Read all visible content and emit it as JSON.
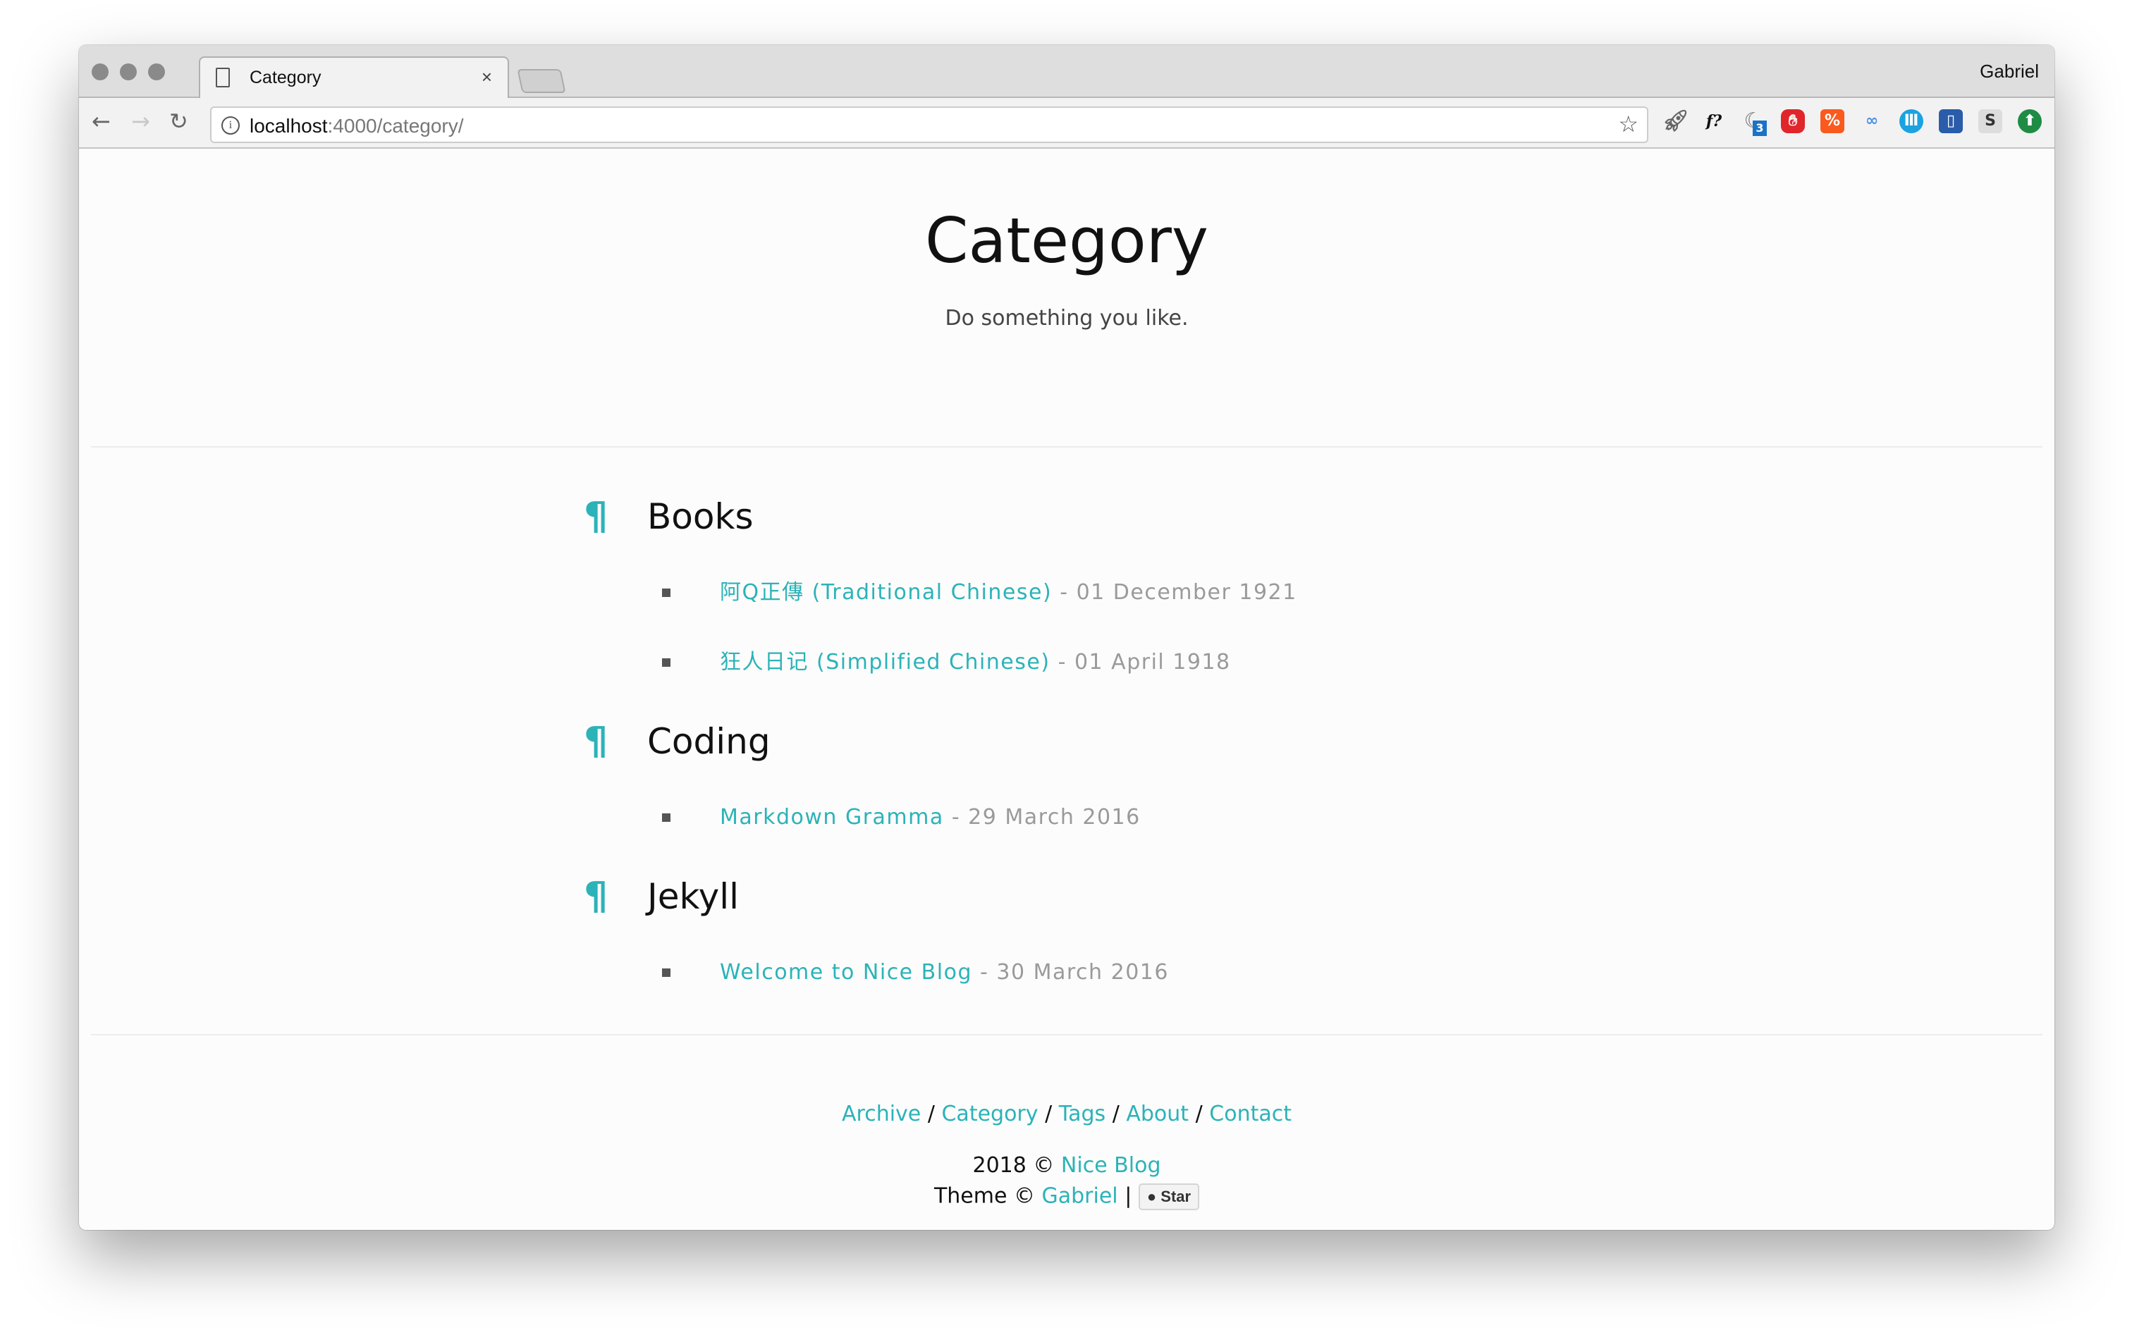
{
  "browser": {
    "tab_title": "Category",
    "profile_name": "Gabriel",
    "url_host": "localhost",
    "url_rest": ":4000/category/",
    "extension_badge": "3",
    "extensions": [
      "rocket-icon",
      "f-question-icon",
      "moon-icon",
      "adblock-hand-icon",
      "code-icon",
      "glasses-icon",
      "museum-icon",
      "notebook-icon",
      "s-icon",
      "upload-arrow-icon"
    ]
  },
  "header": {
    "title": "Category",
    "subtitle": "Do something you like."
  },
  "categories": [
    {
      "name": "Books",
      "marker": "¶",
      "posts": [
        {
          "title": "阿Q正傳 (Traditional Chinese)",
          "date": "- 01 December 1921"
        },
        {
          "title": "狂人日记 (Simplified Chinese)",
          "date": "- 01 April 1918"
        }
      ]
    },
    {
      "name": "Coding",
      "marker": "¶",
      "posts": [
        {
          "title": "Markdown Gramma",
          "date": "- 29 March 2016"
        }
      ]
    },
    {
      "name": "Jekyll",
      "marker": "¶",
      "posts": [
        {
          "title": "Welcome to Nice Blog",
          "date": "- 30 March 2016"
        }
      ]
    }
  ],
  "footer": {
    "links": [
      "Archive",
      "Category",
      "Tags",
      "About",
      "Contact"
    ],
    "separator": "/",
    "copyright_prefix": "2018 ©",
    "blog_name": "Nice Blog",
    "theme_prefix": "Theme ©",
    "theme_author": "Gabriel",
    "pipe": "|",
    "star_label": "Star"
  },
  "colors": {
    "accent": "#2bb3b8",
    "date": "#9a9a9a"
  }
}
